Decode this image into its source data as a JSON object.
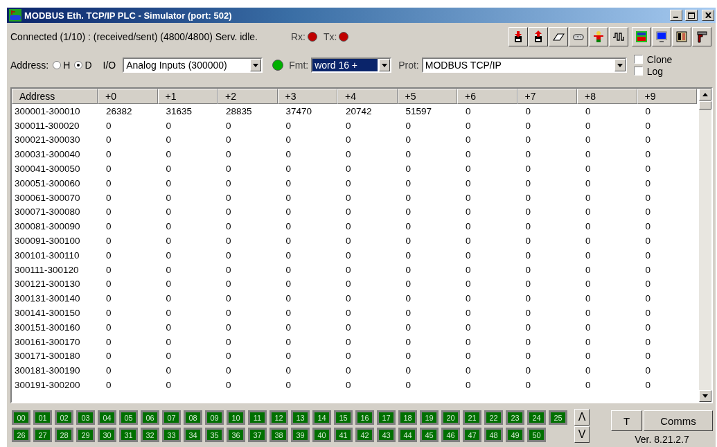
{
  "window": {
    "title": "MODBUS Eth. TCP/IP PLC - Simulator (port: 502)"
  },
  "status": {
    "text": "Connected (1/10) : (received/sent) (4800/4800) Serv. idle.",
    "indicators": [
      {
        "label": "Rx:",
        "color": "#c00000"
      },
      {
        "label": "Tx:",
        "color": "#c00000"
      }
    ]
  },
  "address": {
    "label": "Address:",
    "options": [
      {
        "label": "H",
        "selected": false
      },
      {
        "label": "D",
        "selected": true
      }
    ]
  },
  "io": {
    "label": "I/O",
    "value": "Analog Inputs (300000)"
  },
  "link_led": {
    "color": "#00b000"
  },
  "format": {
    "label": "Fmt:",
    "value": "word 16 +",
    "focused": true
  },
  "protocol": {
    "label": "Prot:",
    "value": "MODBUS TCP/IP"
  },
  "options": [
    {
      "label": "Clone",
      "checked": false
    },
    {
      "label": "Log",
      "checked": false
    }
  ],
  "table": {
    "columns": [
      "Address",
      "+0",
      "+1",
      "+2",
      "+3",
      "+4",
      "+5",
      "+6",
      "+7",
      "+8",
      "+9"
    ],
    "rows": [
      {
        "address": "300001-300010",
        "values": [
          "26382",
          "31635",
          "28835",
          "37470",
          "20742",
          "51597",
          "0",
          "0",
          "0",
          "0"
        ]
      },
      {
        "address": "300011-300020",
        "values": [
          "0",
          "0",
          "0",
          "0",
          "0",
          "0",
          "0",
          "0",
          "0",
          "0"
        ]
      },
      {
        "address": "300021-300030",
        "values": [
          "0",
          "0",
          "0",
          "0",
          "0",
          "0",
          "0",
          "0",
          "0",
          "0"
        ]
      },
      {
        "address": "300031-300040",
        "values": [
          "0",
          "0",
          "0",
          "0",
          "0",
          "0",
          "0",
          "0",
          "0",
          "0"
        ]
      },
      {
        "address": "300041-300050",
        "values": [
          "0",
          "0",
          "0",
          "0",
          "0",
          "0",
          "0",
          "0",
          "0",
          "0"
        ]
      },
      {
        "address": "300051-300060",
        "values": [
          "0",
          "0",
          "0",
          "0",
          "0",
          "0",
          "0",
          "0",
          "0",
          "0"
        ]
      },
      {
        "address": "300061-300070",
        "values": [
          "0",
          "0",
          "0",
          "0",
          "0",
          "0",
          "0",
          "0",
          "0",
          "0"
        ]
      },
      {
        "address": "300071-300080",
        "values": [
          "0",
          "0",
          "0",
          "0",
          "0",
          "0",
          "0",
          "0",
          "0",
          "0"
        ]
      },
      {
        "address": "300081-300090",
        "values": [
          "0",
          "0",
          "0",
          "0",
          "0",
          "0",
          "0",
          "0",
          "0",
          "0"
        ]
      },
      {
        "address": "300091-300100",
        "values": [
          "0",
          "0",
          "0",
          "0",
          "0",
          "0",
          "0",
          "0",
          "0",
          "0"
        ]
      },
      {
        "address": "300101-300110",
        "values": [
          "0",
          "0",
          "0",
          "0",
          "0",
          "0",
          "0",
          "0",
          "0",
          "0"
        ]
      },
      {
        "address": "300111-300120",
        "values": [
          "0",
          "0",
          "0",
          "0",
          "0",
          "0",
          "0",
          "0",
          "0",
          "0"
        ]
      },
      {
        "address": "300121-300130",
        "values": [
          "0",
          "0",
          "0",
          "0",
          "0",
          "0",
          "0",
          "0",
          "0",
          "0"
        ]
      },
      {
        "address": "300131-300140",
        "values": [
          "0",
          "0",
          "0",
          "0",
          "0",
          "0",
          "0",
          "0",
          "0",
          "0"
        ]
      },
      {
        "address": "300141-300150",
        "values": [
          "0",
          "0",
          "0",
          "0",
          "0",
          "0",
          "0",
          "0",
          "0",
          "0"
        ]
      },
      {
        "address": "300151-300160",
        "values": [
          "0",
          "0",
          "0",
          "0",
          "0",
          "0",
          "0",
          "0",
          "0",
          "0"
        ]
      },
      {
        "address": "300161-300170",
        "values": [
          "0",
          "0",
          "0",
          "0",
          "0",
          "0",
          "0",
          "0",
          "0",
          "0"
        ]
      },
      {
        "address": "300171-300180",
        "values": [
          "0",
          "0",
          "0",
          "0",
          "0",
          "0",
          "0",
          "0",
          "0",
          "0"
        ]
      },
      {
        "address": "300181-300190",
        "values": [
          "0",
          "0",
          "0",
          "0",
          "0",
          "0",
          "0",
          "0",
          "0",
          "0"
        ]
      },
      {
        "address": "300191-300200",
        "values": [
          "0",
          "0",
          "0",
          "0",
          "0",
          "0",
          "0",
          "0",
          "0",
          "0"
        ]
      }
    ]
  },
  "coils": [
    {
      "label": "00",
      "on": true
    },
    {
      "label": "01",
      "on": true
    },
    {
      "label": "02",
      "on": true
    },
    {
      "label": "03",
      "on": true
    },
    {
      "label": "04",
      "on": true
    },
    {
      "label": "05",
      "on": true
    },
    {
      "label": "06",
      "on": true
    },
    {
      "label": "07",
      "on": true
    },
    {
      "label": "08",
      "on": true
    },
    {
      "label": "09",
      "on": true
    },
    {
      "label": "10",
      "on": true
    },
    {
      "label": "11",
      "on": true
    },
    {
      "label": "12",
      "on": true
    },
    {
      "label": "13",
      "on": true
    },
    {
      "label": "14",
      "on": true
    },
    {
      "label": "15",
      "on": true
    },
    {
      "label": "16",
      "on": true
    },
    {
      "label": "17",
      "on": true
    },
    {
      "label": "18",
      "on": true
    },
    {
      "label": "19",
      "on": true
    },
    {
      "label": "20",
      "on": true
    },
    {
      "label": "21",
      "on": true
    },
    {
      "label": "22",
      "on": true
    },
    {
      "label": "23",
      "on": true
    },
    {
      "label": "24",
      "on": true
    },
    {
      "label": "25",
      "on": true
    },
    {
      "label": "26",
      "on": true
    },
    {
      "label": "27",
      "on": true
    },
    {
      "label": "28",
      "on": true
    },
    {
      "label": "29",
      "on": true
    },
    {
      "label": "30",
      "on": true
    },
    {
      "label": "31",
      "on": true
    },
    {
      "label": "32",
      "on": true
    },
    {
      "label": "33",
      "on": true
    },
    {
      "label": "34",
      "on": true
    },
    {
      "label": "35",
      "on": true
    },
    {
      "label": "36",
      "on": true
    },
    {
      "label": "37",
      "on": true
    },
    {
      "label": "38",
      "on": true
    },
    {
      "label": "39",
      "on": true
    },
    {
      "label": "40",
      "on": true
    },
    {
      "label": "41",
      "on": true
    },
    {
      "label": "42",
      "on": true
    },
    {
      "label": "43",
      "on": true
    },
    {
      "label": "44",
      "on": true
    },
    {
      "label": "45",
      "on": true
    },
    {
      "label": "46",
      "on": true
    },
    {
      "label": "47",
      "on": true
    },
    {
      "label": "48",
      "on": true
    },
    {
      "label": "49",
      "on": true
    },
    {
      "label": "50",
      "on": true
    }
  ],
  "page_buttons": [
    "Λ",
    "V"
  ],
  "buttons": [
    "T",
    "Comms"
  ],
  "version": "Ver. 8.21.2.7"
}
